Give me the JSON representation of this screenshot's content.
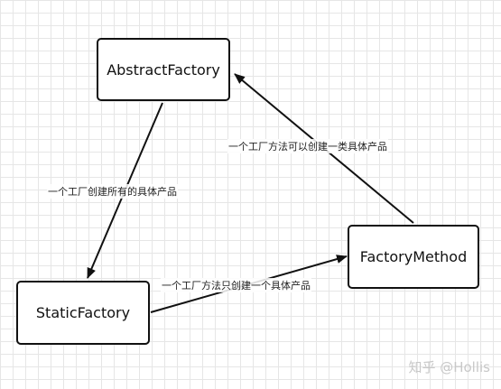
{
  "nodes": {
    "abstract_factory": "AbstractFactory",
    "static_factory": "StaticFactory",
    "factory_method": "FactoryMethod"
  },
  "edges": {
    "abstract_to_static": "一个工厂创建所有的具体产品",
    "method_to_abstract": "一个工厂方法可以创建一类具体产品",
    "static_to_method": "一个工厂方法只创建一个具体产品"
  },
  "watermark": "知乎 @Hollis"
}
